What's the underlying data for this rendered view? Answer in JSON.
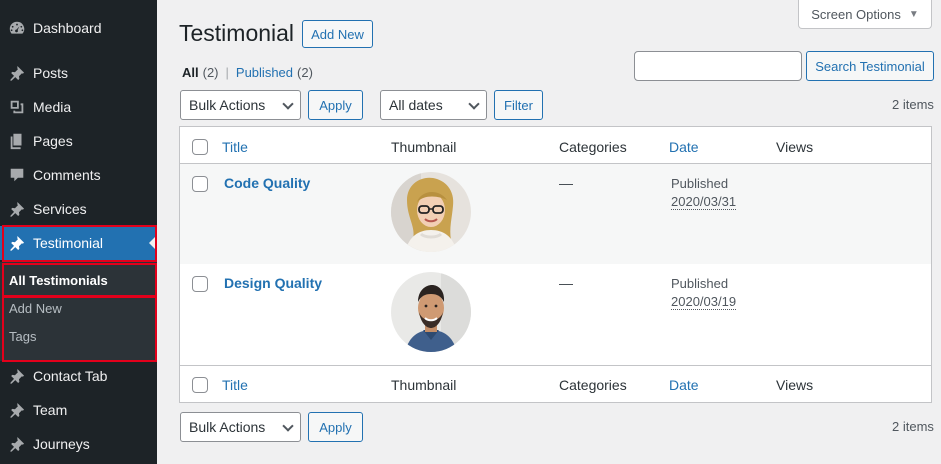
{
  "sidebar": {
    "items": [
      {
        "label": "Dashboard",
        "icon": "dashboard-icon"
      },
      {
        "label": "Posts",
        "icon": "pushpin-icon"
      },
      {
        "label": "Media",
        "icon": "media-icon"
      },
      {
        "label": "Pages",
        "icon": "pages-icon"
      },
      {
        "label": "Comments",
        "icon": "comment-icon"
      },
      {
        "label": "Services",
        "icon": "pushpin-icon"
      },
      {
        "label": "Testimonial",
        "icon": "pushpin-icon",
        "current": true
      },
      {
        "label": "Contact Tab",
        "icon": "pushpin-icon"
      },
      {
        "label": "Team",
        "icon": "pushpin-icon"
      },
      {
        "label": "Journeys",
        "icon": "pushpin-icon"
      }
    ],
    "submenu": [
      {
        "label": "All Testimonials",
        "current": true
      },
      {
        "label": "Add New"
      },
      {
        "label": "Tags"
      }
    ],
    "highlight_color": "#e3001b"
  },
  "header": {
    "title": "Testimonial",
    "add_new": "Add New",
    "screen_options": "Screen Options",
    "screen_options_caret": "▼"
  },
  "views": {
    "all": "All",
    "all_count": "(2)",
    "separator": "|",
    "published": "Published",
    "published_count": "(2)"
  },
  "search": {
    "value": "",
    "button": "Search Testimonial"
  },
  "tablenav_top": {
    "bulk_actions": "Bulk Actions",
    "apply": "Apply",
    "date_filter": "All dates",
    "filter": "Filter",
    "items_count": "2 items"
  },
  "table": {
    "columns": {
      "title": "Title",
      "thumbnail": "Thumbnail",
      "categories": "Categories",
      "date": "Date",
      "views": "Views"
    },
    "rows": [
      {
        "title": "Code Quality",
        "categories": "—",
        "status": "Published",
        "date": "2020/03/31",
        "views": "",
        "thumbnail": "woman-portrait"
      },
      {
        "title": "Design Quality",
        "categories": "—",
        "status": "Published",
        "date": "2020/03/19",
        "views": "",
        "thumbnail": "man-portrait"
      }
    ]
  },
  "tablenav_bottom": {
    "bulk_actions": "Bulk Actions",
    "apply": "Apply",
    "items_count": "2 items"
  },
  "colors": {
    "accent": "#2271b1",
    "sidebar_bg": "#1d2327",
    "submenu_bg": "#2c3338"
  }
}
